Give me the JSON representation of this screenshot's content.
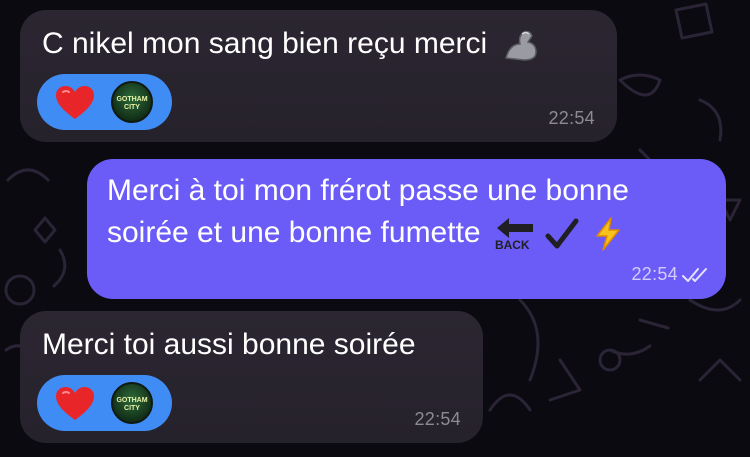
{
  "colors": {
    "background": "#0b0a10",
    "incoming_bubble": "#2b2631",
    "outgoing_bubble": "#6b5cf7",
    "reaction_pill": "#3f8cf5",
    "heart": "#e8262a"
  },
  "messages": [
    {
      "direction": "incoming",
      "text": "C nikel mon sang bien reçu merci",
      "emoji_icon": "flexed-biceps-icon",
      "time": "22:54",
      "reactions": [
        "heart-icon",
        "reaction-avatar"
      ],
      "reaction_avatar_text": "GOTHAM CITY"
    },
    {
      "direction": "outgoing",
      "line1": "Merci à toi mon frérot passe une bonne",
      "line2": "soirée et une bonne fumette",
      "emoji_icons": [
        "back-arrow-icon",
        "check-mark-icon",
        "lightning-icon"
      ],
      "back_label": "BACK",
      "time": "22:54",
      "status_icon": "double-check-read-icon"
    },
    {
      "direction": "incoming",
      "text": "Merci toi aussi bonne soirée",
      "time": "22:54",
      "reactions": [
        "heart-icon",
        "reaction-avatar"
      ],
      "reaction_avatar_text": "GOTHAM CITY"
    }
  ]
}
